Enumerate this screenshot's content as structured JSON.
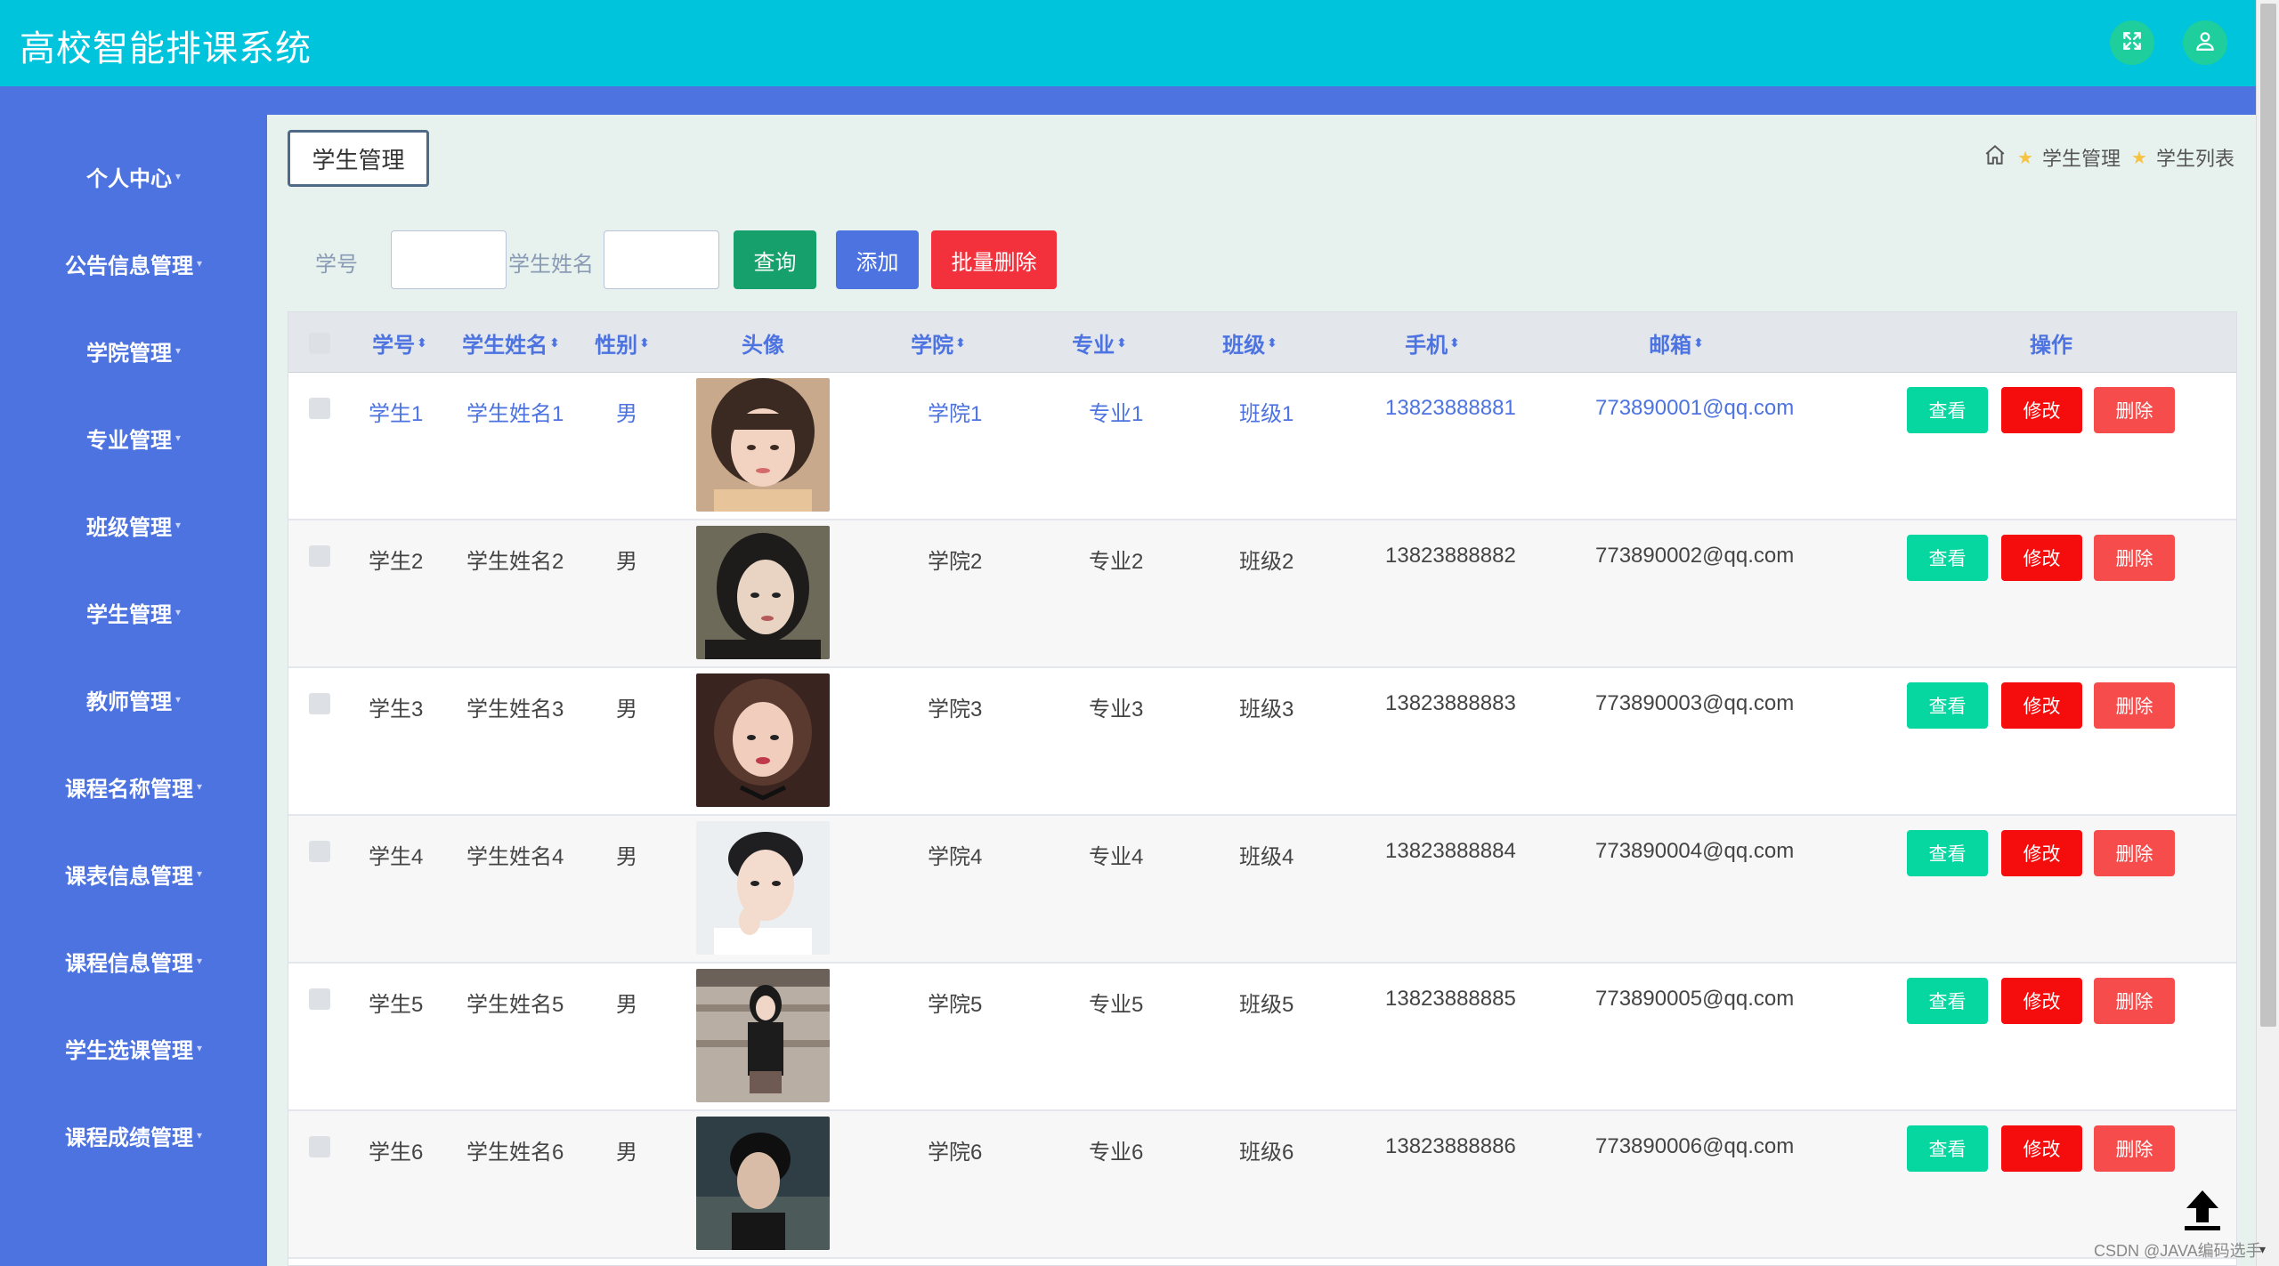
{
  "app": {
    "title": "高校智能排课系统"
  },
  "topbar": {
    "fullscreen_icon": "expand-icon",
    "user_icon": "user-icon"
  },
  "sidebar": {
    "items": [
      {
        "label": "个人中心"
      },
      {
        "label": "公告信息管理"
      },
      {
        "label": "学院管理"
      },
      {
        "label": "专业管理"
      },
      {
        "label": "班级管理"
      },
      {
        "label": "学生管理"
      },
      {
        "label": "教师管理"
      },
      {
        "label": "课程名称管理"
      },
      {
        "label": "课表信息管理"
      },
      {
        "label": "课程信息管理"
      },
      {
        "label": "学生选课管理"
      },
      {
        "label": "课程成绩管理"
      }
    ]
  },
  "page": {
    "title": "学生管理",
    "breadcrumb": [
      "学生管理",
      "学生列表"
    ]
  },
  "search": {
    "id_label": "学号",
    "id_value": "",
    "name_label": "学生姓名",
    "name_value": "",
    "query_label": "查询",
    "add_label": "添加",
    "batch_delete_label": "批量删除"
  },
  "table": {
    "headers": {
      "id": "学号",
      "name": "学生姓名",
      "gender": "性别",
      "avatar": "头像",
      "college": "学院",
      "major": "专业",
      "class": "班级",
      "phone": "手机",
      "email": "邮箱",
      "actions": "操作"
    },
    "sort_glyph": "⬍",
    "action_labels": {
      "view": "查看",
      "edit": "修改",
      "delete": "删除"
    },
    "rows": [
      {
        "id": "学生1",
        "name": "学生姓名1",
        "gender": "男",
        "college": "学院1",
        "major": "专业1",
        "class": "班级1",
        "phone": "13823888881",
        "email": "773890001@qq.com"
      },
      {
        "id": "学生2",
        "name": "学生姓名2",
        "gender": "男",
        "college": "学院2",
        "major": "专业2",
        "class": "班级2",
        "phone": "13823888882",
        "email": "773890002@qq.com"
      },
      {
        "id": "学生3",
        "name": "学生姓名3",
        "gender": "男",
        "college": "学院3",
        "major": "专业3",
        "class": "班级3",
        "phone": "13823888883",
        "email": "773890003@qq.com"
      },
      {
        "id": "学生4",
        "name": "学生姓名4",
        "gender": "男",
        "college": "学院4",
        "major": "专业4",
        "class": "班级4",
        "phone": "13823888884",
        "email": "773890004@qq.com"
      },
      {
        "id": "学生5",
        "name": "学生姓名5",
        "gender": "男",
        "college": "学院5",
        "major": "专业5",
        "class": "班级5",
        "phone": "13823888885",
        "email": "773890005@qq.com"
      },
      {
        "id": "学生6",
        "name": "学生姓名6",
        "gender": "男",
        "college": "学院6",
        "major": "专业6",
        "class": "班级6",
        "phone": "13823888886",
        "email": "773890006@qq.com"
      }
    ]
  },
  "footer": {
    "watermark": "CSDN @JAVA编码选手"
  },
  "colors": {
    "topbar": "#00c3dc",
    "sidebar": "#4d73e0",
    "accent": "#4d73e0",
    "view_button": "#06d6a0",
    "edit_button": "#f50d0d",
    "delete_button": "#f64c4c"
  }
}
